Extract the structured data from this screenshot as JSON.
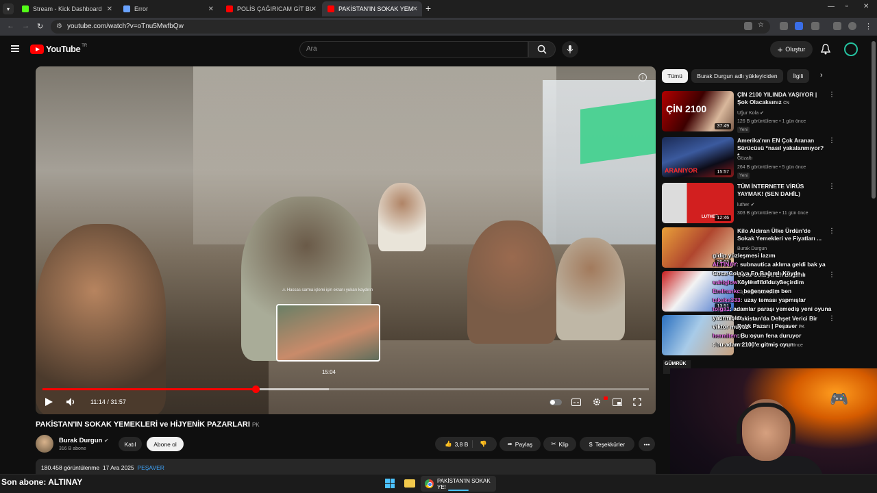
{
  "browser": {
    "tabs": [
      {
        "title": "Stream - Kick Dashboard",
        "color": "#53fc18"
      },
      {
        "title": "Error",
        "color": "#6aa3ff"
      },
      {
        "title": "POLİS ÇAĞIRICAM GİT BURDAN",
        "color": "#ff0000"
      },
      {
        "title": "PAKİSTAN'IN SOKAK YEMEKLERİ",
        "color": "#ff0000"
      }
    ],
    "url": "youtube.com/watch?v=oTnu5MwfbQw"
  },
  "youtube": {
    "logo_text": "YouTube",
    "country": "TR",
    "search_placeholder": "Ara",
    "create_label": "Oluştur"
  },
  "player": {
    "hover_time": "15:04",
    "preview_note": "⚠ Hassas sarma işlemi için ekranı yukarı kaydırın",
    "current_time": "11:14",
    "duration": "31:57",
    "progress_fraction": 0.351,
    "buffer_fraction": 0.472
  },
  "video": {
    "title": "PAKİSTAN'IN SOKAK YEMEKLERİ ve HİJYENİK PAZARLARI",
    "country_badge": "PK",
    "channel": "Burak Durgun",
    "subscribers": "316 B abone",
    "join_label": "Katıl",
    "subscribe_label": "Abone ol",
    "likes": "3,8 B",
    "share_label": "Paylaş",
    "clip_label": "Klip",
    "thanks_label": "Teşekkürler",
    "views": "180.458 görüntülenme",
    "date": "17 Ara 2025",
    "hashtag": "PEŞAVER"
  },
  "sidebar": {
    "chips": [
      "Tümü",
      "Burak Durgun adlı yükleyiciden",
      "İlgili"
    ],
    "recs": [
      {
        "title": "ÇİN 2100 YILINDA YAŞIYOR | Şok Olacaksınız",
        "badge": "CN",
        "channel": "Uğur Kola",
        "stats": "126 B görüntüleme • 1 gün önce",
        "duration": "37:49",
        "new": "Yeni",
        "thumb_text": "ÇİN 2100"
      },
      {
        "title": "Amerika'nın EN Çok Aranan Sürücüsü *nasıl yakalanmıyor?*",
        "badge": "",
        "channel": "Gözaltı",
        "stats": "264 B görüntüleme • 5 gün önce",
        "duration": "15:57",
        "new": "Yeni",
        "thumb_text": "ARANIYOR"
      },
      {
        "title": "TÜM İNTERNETE VİRÜS YAYMAK! (SEN DAHİL)",
        "badge": "",
        "channel": "luther",
        "stats": "303 B görüntüleme • 11 gün önce",
        "duration": "12:46",
        "new": "",
        "thumb_text": "LUTHER"
      },
      {
        "title": "Kilo Aldıran Ülke Ürdün'de Sokak Yemekleri ve Fiyatları ...",
        "badge": "",
        "channel": "Burak Durgun",
        "stats": "",
        "duration": "25:03",
        "new": "",
        "thumb_text": ""
      },
      {
        "title": "Coca-Cola'ya En Bağımlı Köyde 24 Saat Geçirdim",
        "badge": "",
        "channel": "Köyhan Maceraları",
        "stats": "",
        "duration": "13:51",
        "new": "",
        "thumb_text": ""
      },
      {
        "title": "Pakistan'da Dehşet Verici Bir Balık Pazarı | Peşaver",
        "badge": "PK",
        "channel": "Uğur Kola",
        "stats": "204 B görüntüleme • 1 ay önce",
        "duration": "",
        "new": "",
        "thumb_text": ""
      }
    ]
  },
  "stream": {
    "chat": [
      {
        "user": "",
        "msg": "gidip yüzleşmesi lazım"
      },
      {
        "user": "ALTINAY",
        "msg": ": subnautica aklıma geldi bak ya"
      },
      {
        "user": "",
        "msg": "Coca-Cola'ya En Bağımlı Köyde"
      },
      {
        "user": "sahiglow",
        "msg": ": öyle mi oldu ya"
      },
      {
        "user": "Emlhankc",
        "msg": ": beğenmedim ben"
      },
      {
        "user": "takaka333",
        "msg": ": uzay teması yapmışlar"
      },
      {
        "user": "tolga1",
        "msg": ": adamlar paraşı yemediş yeni oyuna"
      },
      {
        "user": "",
        "msg": "yatırmışlar"
      },
      {
        "user": "",
        "msg": "viktor muyuz"
      },
      {
        "user": "hermiten",
        "msg": ": Bu oyun fena duruyor"
      },
      {
        "user": "",
        "msg": ": bu adam 2100'e gitmiş oyun"
      }
    ],
    "thumb_label": "GÜMRÜK",
    "last_subscriber": "Son abone: ALTINAY",
    "taskbar_app": "PAKİSTAN'IN SOKAK YE!"
  }
}
